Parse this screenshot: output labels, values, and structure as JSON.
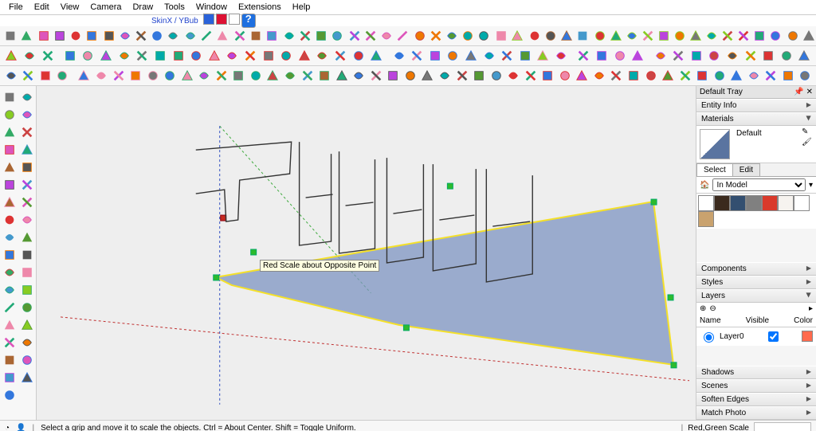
{
  "menu": [
    "File",
    "Edit",
    "View",
    "Camera",
    "Draw",
    "Tools",
    "Window",
    "Extensions",
    "Help"
  ],
  "skin_label": "SkinX / YBub",
  "tool_rows": [
    [
      "cursor",
      "eraser",
      "sep",
      "pencil",
      "rect",
      "circle",
      "arc",
      "sep",
      "paint",
      "text",
      "dims",
      "tape",
      "prot",
      "sep",
      "push",
      "follow",
      "offset",
      "sep",
      "move",
      "rotate",
      "scale",
      "sep",
      "sel1",
      "sel2",
      "sel3",
      "sel4",
      "sep",
      "orbit",
      "pan",
      "zoom",
      "zoom-ex",
      "sep",
      "iso",
      "top",
      "front",
      "side",
      "back",
      "sep",
      "prev",
      "next",
      "sep",
      "shadow",
      "fog",
      "xray",
      "hidden",
      "sep",
      "a1",
      "a2",
      "a3",
      "a4",
      "a5",
      "a6",
      "a7",
      "a8",
      "a9",
      "a10",
      "a11",
      "a12",
      "sep",
      "sun1",
      "sun2",
      "sun3",
      "sun4",
      "sun5",
      "sun6",
      "sun7",
      "sun8"
    ],
    [
      "b1",
      "b2",
      "b3",
      "sep",
      "b4",
      "b5",
      "b6",
      "b7",
      "b8",
      "b9",
      "b10",
      "b11",
      "b12",
      "b13",
      "b14",
      "b15",
      "b16",
      "b17",
      "b18",
      "b19",
      "b20",
      "b21",
      "sep",
      "b22",
      "b23",
      "b24",
      "b25",
      "b26",
      "b27",
      "b28",
      "b29",
      "b30",
      "b31",
      "sep",
      "b32",
      "b33",
      "b34",
      "b35",
      "sep",
      "b36",
      "b37",
      "b38",
      "b39",
      "b40",
      "b41",
      "b42",
      "b43",
      "b44"
    ],
    [
      "c1",
      "c2",
      "c3",
      "c4",
      "sep",
      "c5",
      "c6",
      "c7",
      "c8",
      "c9",
      "c10",
      "c11",
      "c12",
      "c13",
      "c14",
      "c15",
      "c16",
      "c17",
      "c18",
      "c19",
      "c20",
      "c21",
      "c22",
      "c23",
      "c24",
      "c25",
      "c26",
      "c27",
      "c28",
      "c29",
      "c30",
      "c31",
      "c32",
      "c33",
      "c34",
      "c35",
      "c36",
      "c37",
      "c38",
      "c39",
      "c40",
      "c41",
      "c42",
      "c43",
      "c44",
      "c45",
      "c46",
      "c47"
    ]
  ],
  "left_tools": [
    "cursor",
    "hand",
    "eraser",
    "pencil",
    "freehand",
    "rect",
    "rotrect",
    "circle",
    "polygon",
    "arc",
    "pie",
    "push",
    "follow",
    "offset",
    "move",
    "rotate",
    "scale",
    "tape",
    "prot",
    "text",
    "dim",
    "axis",
    "paint",
    "orbit",
    "pan",
    "zoom",
    "zoomwin",
    "zoomext",
    "prev",
    "cam",
    "walk",
    "look",
    "section",
    "sand1",
    "sand2"
  ],
  "tray": {
    "title": "Default Tray",
    "panels": {
      "entity_info": "Entity Info",
      "materials": "Materials",
      "material_name": "Default",
      "select_tab": "Select",
      "edit_tab": "Edit",
      "in_model": "In Model",
      "swatches": [
        "#ffffff",
        "#3b2a1d",
        "#334f70",
        "#808080",
        "#d93a2b",
        "#f6f3ef",
        "#ffffff",
        "#c9a26e"
      ],
      "components": "Components",
      "styles": "Styles",
      "layers": "Layers",
      "layer_hd_name": "Name",
      "layer_hd_vis": "Visible",
      "layer_hd_color": "Color",
      "layer0": "Layer0",
      "shadows": "Shadows",
      "scenes": "Scenes",
      "soften": "Soften Edges",
      "match": "Match Photo"
    }
  },
  "tooltip": "Red Scale about Opposite Point",
  "status": {
    "hint": "Select a grip and move it to scale the objects. Ctrl = About Center. Shift = Toggle Uniform.",
    "measure_label": "Red,Green Scale"
  }
}
